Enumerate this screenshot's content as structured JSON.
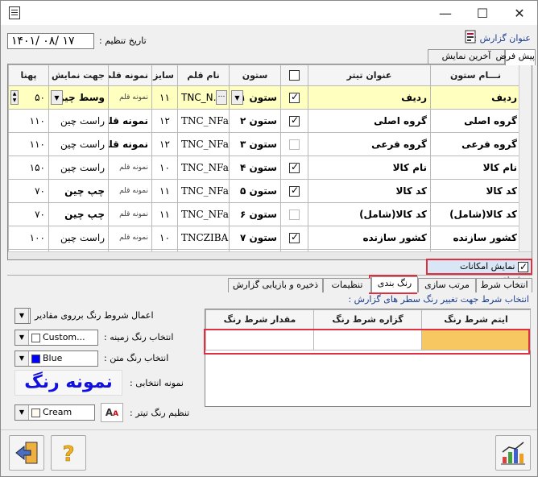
{
  "window": {
    "minimize": "—",
    "maximize": "☐",
    "close": "✕"
  },
  "header": {
    "report_title_label": "عنوان گزارش :",
    "date_label": "تاریخ تنظیم :",
    "date_value": "۱۴۰۱/ ۰۸/ ۱۷"
  },
  "top_tabs": [
    "پیش فرض",
    "آخرین نمایش"
  ],
  "grid": {
    "columns": [
      "نـــام ستون",
      "عنوان تیتر",
      "",
      "ستون",
      "نام قلم",
      "سایز",
      "نمونه قلم",
      "جهت نمایش",
      "پهنا"
    ],
    "rows": [
      {
        "name": "ردیف",
        "title": "ردیف",
        "checked": true,
        "col": "ستون ۱",
        "font": "TNC_N…",
        "size": "۱۱",
        "sample": "نمونه قلم",
        "align": "وسط چین",
        "width": "۵۰"
      },
      {
        "name": "گروه اصلی",
        "title": "گروه اصلی",
        "checked": true,
        "col": "ستون ۲",
        "font": "TNC_NFa",
        "size": "۱۲",
        "sample": "نمونه قلم",
        "align": "راست چین",
        "width": "۱۱۰"
      },
      {
        "name": "گروه فرعی",
        "title": "گروه فرعی",
        "checked": false,
        "col": "ستون ۳",
        "font": "TNC_NFa",
        "size": "۱۲",
        "sample": "نمونه قلم",
        "align": "راست چین",
        "width": "۱۱۰"
      },
      {
        "name": "نام کالا",
        "title": "نام کالا",
        "checked": true,
        "col": "ستون ۴",
        "font": "TNC_NFa",
        "size": "۱۰",
        "sample": "نمونه قلم",
        "align": "راست چین",
        "width": "۱۵۰"
      },
      {
        "name": "کد کالا",
        "title": "کد کالا",
        "checked": true,
        "col": "ستون ۵",
        "font": "TNC_NFa",
        "size": "۱۱",
        "sample": "نمونه قلم",
        "align": "چپ چین",
        "width": "۷۰"
      },
      {
        "name": "کد کالا(شامل)",
        "title": "کد کالا(شامل)",
        "checked": false,
        "col": "ستون ۶",
        "font": "TNC_NFa",
        "size": "۱۱",
        "sample": "نمونه قلم",
        "align": "چپ چین",
        "width": "۷۰"
      },
      {
        "name": "کشور سازنده",
        "title": "کشور سازنده",
        "checked": true,
        "col": "ستون ۷",
        "font": "TNCZIBA",
        "size": "۱۰",
        "sample": "نمونه قلم",
        "align": "راست چین",
        "width": "۱۰۰"
      },
      {
        "name": "",
        "title": "",
        "checked": false,
        "col": "",
        "font": "TNCZIBA",
        "size": "",
        "sample": "",
        "align": "",
        "width": ""
      }
    ]
  },
  "advanced": {
    "label": "نمایش امکانات پیشرفته",
    "checked": true
  },
  "bottom_tabs": [
    "انتخاب شرط",
    "مرتب سازی",
    "رنگ بندی",
    "تنظیمات",
    "ذخیره و بازیابی گزارش"
  ],
  "color_panel": {
    "hint": "انتخاب شرط جهت تغییر رنگ سطر های گزارش :",
    "apply_label": "اعمال شروط رنگ برروی مقادیر",
    "bg_label": "انتخاب رنگ زمینه :",
    "bg_value": "Custom...",
    "text_label": "انتخاب رنگ متن :",
    "text_value": "Blue",
    "sample_label": "نمونه انتخابی :",
    "sample_text": "نمونه رنگ",
    "header_label": "تنظیم رنگ تیتر :",
    "header_value": "Cream",
    "table_headers": [
      "ایتم شرط رنگ",
      "گزاره شرط رنگ",
      "مقدار شرط رنگ"
    ],
    "colors": {
      "bg": "#f7c862",
      "text": "#1010e0",
      "header": "#fffbf0"
    }
  }
}
